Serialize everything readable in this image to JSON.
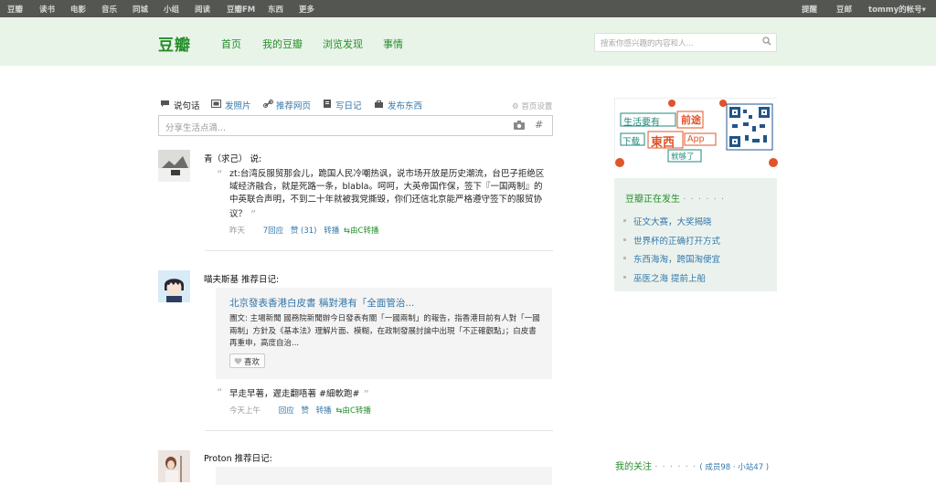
{
  "topbar": {
    "left": [
      "豆瓣",
      "读书",
      "电影",
      "音乐",
      "同城",
      "小组",
      "阅读",
      "豆瓣FM",
      "东西",
      "更多"
    ],
    "right": [
      "提醒",
      "豆邮",
      "tommy的帐号▾"
    ]
  },
  "header": {
    "logo": "豆瓣",
    "nav": [
      "首页",
      "我的豆瓣",
      "浏览发现",
      "事情"
    ],
    "search_placeholder": "搜索你感兴趣的内容和人..."
  },
  "composer": {
    "tools": [
      "说句话",
      "发照片",
      "推荐网页",
      "写日记",
      "发布东西"
    ],
    "settings": "首页设置",
    "placeholder": "分享生活点滴...",
    "hash": "#"
  },
  "feed": [
    {
      "user": "青（求己） 说:",
      "text": "zt:台湾反服贸那会儿，跪国人民冷嘲热讽，说市场开放是历史潮流，台巴子拒绝区域经济融合，就是死路一条，blabla。呵呵，大英帝国作保，签下『一国两制』的中英联合声明，不到二十年就被我党撕毁，你们还信北京能严格遵守签下的服贸协议？",
      "time": "昨天",
      "replies": "7回应",
      "likes": "赞 (31)",
      "share": "转播",
      "via": "由C转播"
    },
    {
      "user": "喵夫斯基 推荐日记:",
      "card_title": "北京發表香港白皮書 稱對港有「全面管治...",
      "card_abstract": "團文: 主場新聞 國務院新聞辦今日發表有關「一國兩制」的報告，指香港目前有人對「一國兩制」方針及《基本法》理解片面、模糊，在政制發展討論中出現「不正確觀點」；白皮書再重申，高度自治...",
      "card_like": "喜欢",
      "text": "早走早著，遲走翻唔著 #細軟跑#",
      "time": "今天上午",
      "replies": "回应",
      "likes": "赞",
      "share": "转播",
      "via": "由C转播"
    },
    {
      "user": "Proton 推荐日记:"
    }
  ],
  "sidebar": {
    "ad_line1": "生活要有",
    "ad_line1b": "前途",
    "ad_line2": "下载",
    "ad_brand": "東西",
    "ad_app": "App",
    "ad_line3": "就够了",
    "now_title": "豆瓣正在发生",
    "now_dots": "· · · · · ·",
    "now_items": [
      "征文大赛，大奖揭晓",
      "世界杯的正确打开方式",
      "东西海淘，跨国淘便宜",
      "巫医之海 提前上船"
    ],
    "follow_title": "我的关注",
    "follow_dots": "· · · · · ·",
    "follow_counts": "( 成员98 · 小站47 )"
  },
  "colors": {
    "brand": "#268d2b",
    "link": "#3377aa",
    "topbar": "#545652",
    "header": "#e9f4e9"
  }
}
